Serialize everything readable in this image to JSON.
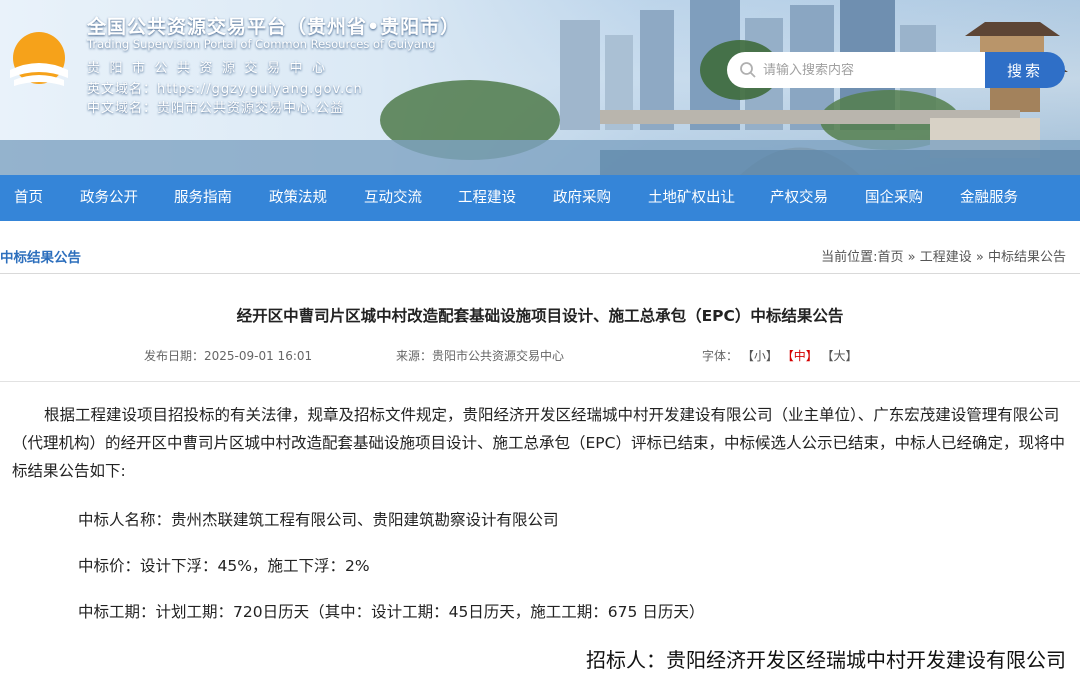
{
  "header": {
    "title": "全国公共资源交易平台（贵州省•贵阳市）",
    "subtitle": "Trading Supervision Portal of Common Resources of Guiyang",
    "line1": "贵阳市公共资源交易中心",
    "line2": "英文域名：https://ggzy.guiyang.gov.cn",
    "line3": "中文域名：贵阳市公共资源交易中心.公益",
    "logo_icon": "sun-over-water-logo-icon"
  },
  "search": {
    "placeholder": "请输入搜索内容",
    "button_label": "搜索",
    "icon": "search-icon"
  },
  "nav": {
    "items": [
      "首页",
      "政务公开",
      "服务指南",
      "政策法规",
      "互动交流",
      "工程建设",
      "政府采购",
      "土地矿权出让",
      "产权交易",
      "国企采购",
      "金融服务"
    ]
  },
  "section": {
    "title": "中标结果公告",
    "crumb_prefix": "当前位置:",
    "crumbs": [
      "首页",
      "工程建设",
      "中标结果公告"
    ],
    "separator": "»"
  },
  "article": {
    "title": "经开区中曹司片区城中村改造配套基础设施项目设计、施工总承包（EPC）中标结果公告",
    "date": "发布日期：2025-09-01 16:01",
    "source": "来源：贵阳市公共资源交易中心",
    "font_label": "字体：",
    "font_sizes": [
      "【小】",
      "【中】",
      "【大】"
    ],
    "paragraph": "根据工程建设项目招投标的有关法律，规章及招标文件规定，贵阳经济开发区经瑞城中村开发建设有限公司（业主单位）、广东宏茂建设管理有限公司（代理机构）的经开区中曹司片区城中村改造配套基础设施项目设计、施工总承包（EPC）评标已结束，中标候选人公示已结束，中标人已经确定，现将中标结果公告如下:",
    "items": [
      "中标人名称：贵州杰联建筑工程有限公司、贵阳建筑勘察设计有限公司",
      "中标价：设计下浮：45%，施工下浮：2%",
      "中标工期：计划工期：720日历天（其中：设计工期：45日历天，施工工期：675 日历天）"
    ],
    "signer": "招标人：贵阳经济开发区经瑞城中村开发建设有限公司"
  },
  "colors": {
    "nav_bg": "#3585d8",
    "search_button": "#2f6fc7",
    "section_title": "#2d6fbd",
    "active_font": "#d40000"
  }
}
